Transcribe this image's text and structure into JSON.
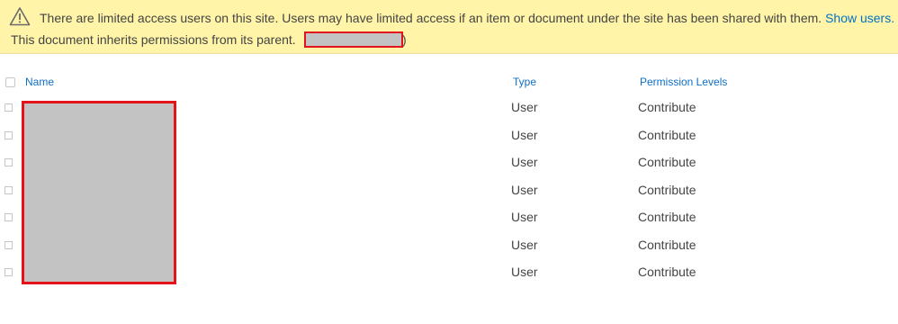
{
  "notice": {
    "message": "There are limited access users on this site. Users may have limited access if an item or document under the site has been shared with them.",
    "show_users_link": "Show users.",
    "inherit_text": "This document inherits permissions from its parent.",
    "close_paren": ")"
  },
  "table": {
    "columns": [
      "Name",
      "Type",
      "Permission Levels"
    ],
    "rows": [
      {
        "type": "User",
        "permission": "Contribute"
      },
      {
        "type": "User",
        "permission": "Contribute"
      },
      {
        "type": "User",
        "permission": "Contribute"
      },
      {
        "type": "User",
        "permission": "Contribute"
      },
      {
        "type": "User",
        "permission": "Contribute"
      },
      {
        "type": "User",
        "permission": "Contribute"
      },
      {
        "type": "User",
        "permission": "Contribute"
      }
    ]
  },
  "colors": {
    "banner_bg": "#fff4a8",
    "link": "#0072c6",
    "redaction_border": "#e3131b",
    "redaction_fill": "#c3c3c3"
  }
}
